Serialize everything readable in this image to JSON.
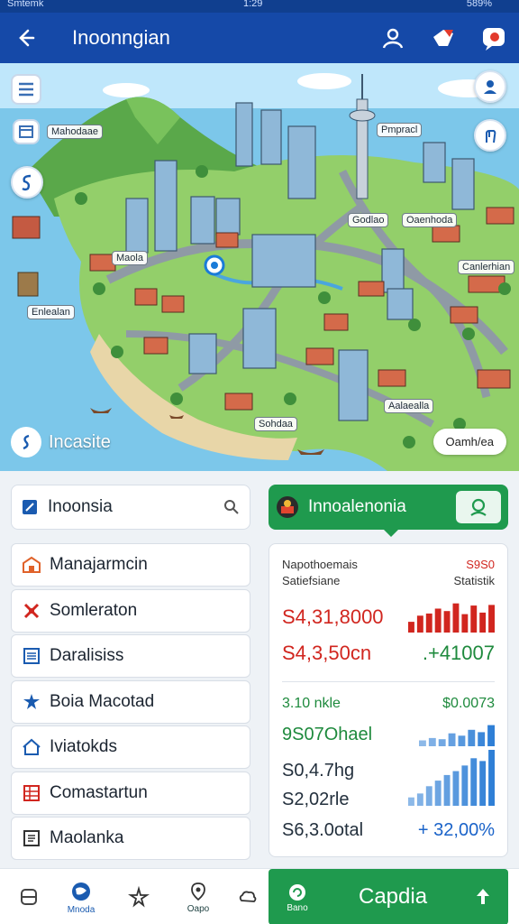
{
  "app": {
    "title": "Inoonngian",
    "status_left": "Smtemk",
    "status_center": "1:29",
    "status_right": "589%"
  },
  "map": {
    "labels": {
      "north": "Mahodaae",
      "port": "Pmpracl",
      "center": "Godlao",
      "center2": "Oaenhoda",
      "west": "Maola",
      "southwest": "Enlealan",
      "east": "Canlerhian",
      "south": "Sohdaa",
      "southeast": "Aalaealla"
    },
    "incasite": "Incasite",
    "camera_chip": "Oamh/ea"
  },
  "search": {
    "value": "Inoonsia"
  },
  "region": {
    "title": "Innoalenonia"
  },
  "menu": [
    {
      "label": "Manajarmcin",
      "icon": "building-icon"
    },
    {
      "label": "Somleraton",
      "icon": "heart-x-icon"
    },
    {
      "label": "Daralisiss",
      "icon": "list-doc-icon"
    },
    {
      "label": "Boia Macotad",
      "icon": "gear-star-icon"
    },
    {
      "label": "Iviatokds",
      "icon": "house-icon"
    },
    {
      "label": "Comastartun",
      "icon": "grid-icon"
    },
    {
      "label": "Maolanka",
      "icon": "doc-grid-icon"
    }
  ],
  "stats": {
    "head_left_1": "Napothoemais",
    "head_left_2": "Satiefsiane",
    "head_right_1": "S9S0",
    "head_right_2": "Statistik",
    "r1_value": "S4,31,8000",
    "r2_value": "S4,3,50cn",
    "r2_delta": ".+41007",
    "r3_label": "3.10 nkle",
    "r3_right": "$0.0073",
    "r4_value": "9S07Ohael",
    "r5_value": "S0,4.7hg",
    "r6_value": "S2,02rle",
    "r7_value": "S6,3.0otal",
    "r7_delta": "+ 32,00%",
    "bars_red": [
      0.35,
      0.55,
      0.62,
      0.78,
      0.7,
      0.95,
      0.6,
      0.88,
      0.65,
      0.9
    ],
    "bars_blue_top": [
      0.25,
      0.35,
      0.3,
      0.55,
      0.45,
      0.7,
      0.6,
      0.9
    ],
    "bars_blue_bottom": [
      0.15,
      0.22,
      0.35,
      0.45,
      0.55,
      0.62,
      0.72,
      0.85,
      0.8,
      1.0
    ],
    "colors": {
      "red": "#d1261f",
      "blue": "#2f7fd6",
      "green": "#1e8a3d"
    }
  },
  "bottom_nav": {
    "tab1": "",
    "tab2": "Mnoda",
    "tab3": "",
    "tab4": "Oapo",
    "tab5": "",
    "cta_small": "Bano",
    "cta_label": "Capdia"
  }
}
